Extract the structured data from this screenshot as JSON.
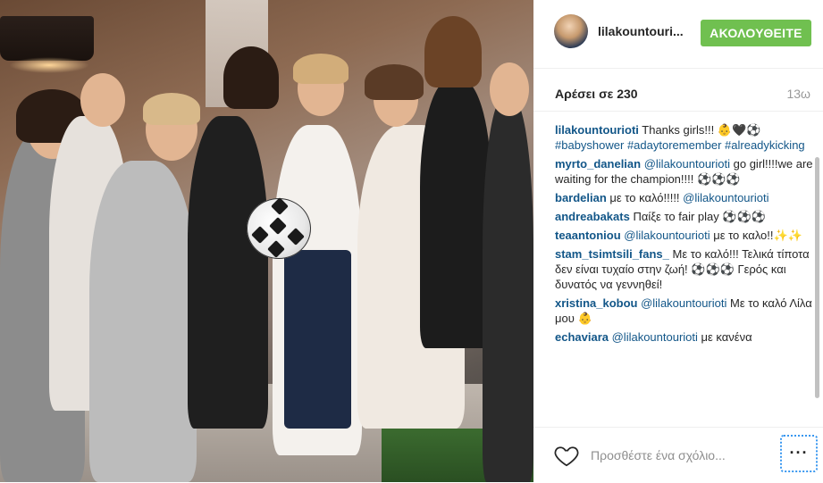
{
  "header": {
    "username": "lilakountouri...",
    "follow_label": "ΑΚΟΛΟΥΘΕΙΤΕ"
  },
  "stats": {
    "likes": "Αρέσει σε 230",
    "time": "13ω"
  },
  "comments": [
    {
      "user": "lilakountourioti",
      "text": " Thanks girls!!! 👶🖤⚽",
      "tags": "#babyshower #adaytoremember #alreadykicking"
    },
    {
      "user": "myrto_danelian",
      "mention": " @lilakountourioti",
      "text": " go girl!!!!we are waiting for the champion!!!! ⚽⚽⚽"
    },
    {
      "user": "bardelian",
      "text": " με το καλό!!!!! ",
      "mention": "@lilakountourioti"
    },
    {
      "user": "andreabakats",
      "text": " Παίξε το fair play ⚽⚽⚽"
    },
    {
      "user": "teaantoniou",
      "mention": " @lilakountourioti",
      "text": " με το καλο!!✨✨"
    },
    {
      "user": "stam_tsimtsili_fans_",
      "text": " Με το καλό!!! Τελικά τίποτα δεν είναι τυχαίο στην ζωή! ⚽⚽⚽ Γερός και δυνατός να γεννηθεί!"
    },
    {
      "user": "xristina_kobou",
      "mention": " @lilakountourioti",
      "text": " Με το καλό Λίλα μου 👶"
    },
    {
      "user": "echaviara",
      "mention": " @lilakountourioti",
      "text": " με κανένα"
    }
  ],
  "footer": {
    "comment_placeholder": "Προσθέστε ένα σχόλιο...",
    "more_label": "···"
  },
  "icons": {
    "like": "heart-icon",
    "more": "more-options-icon",
    "avatar": "profile-avatar"
  },
  "colors": {
    "follow": "#70c050",
    "link": "#125688"
  }
}
